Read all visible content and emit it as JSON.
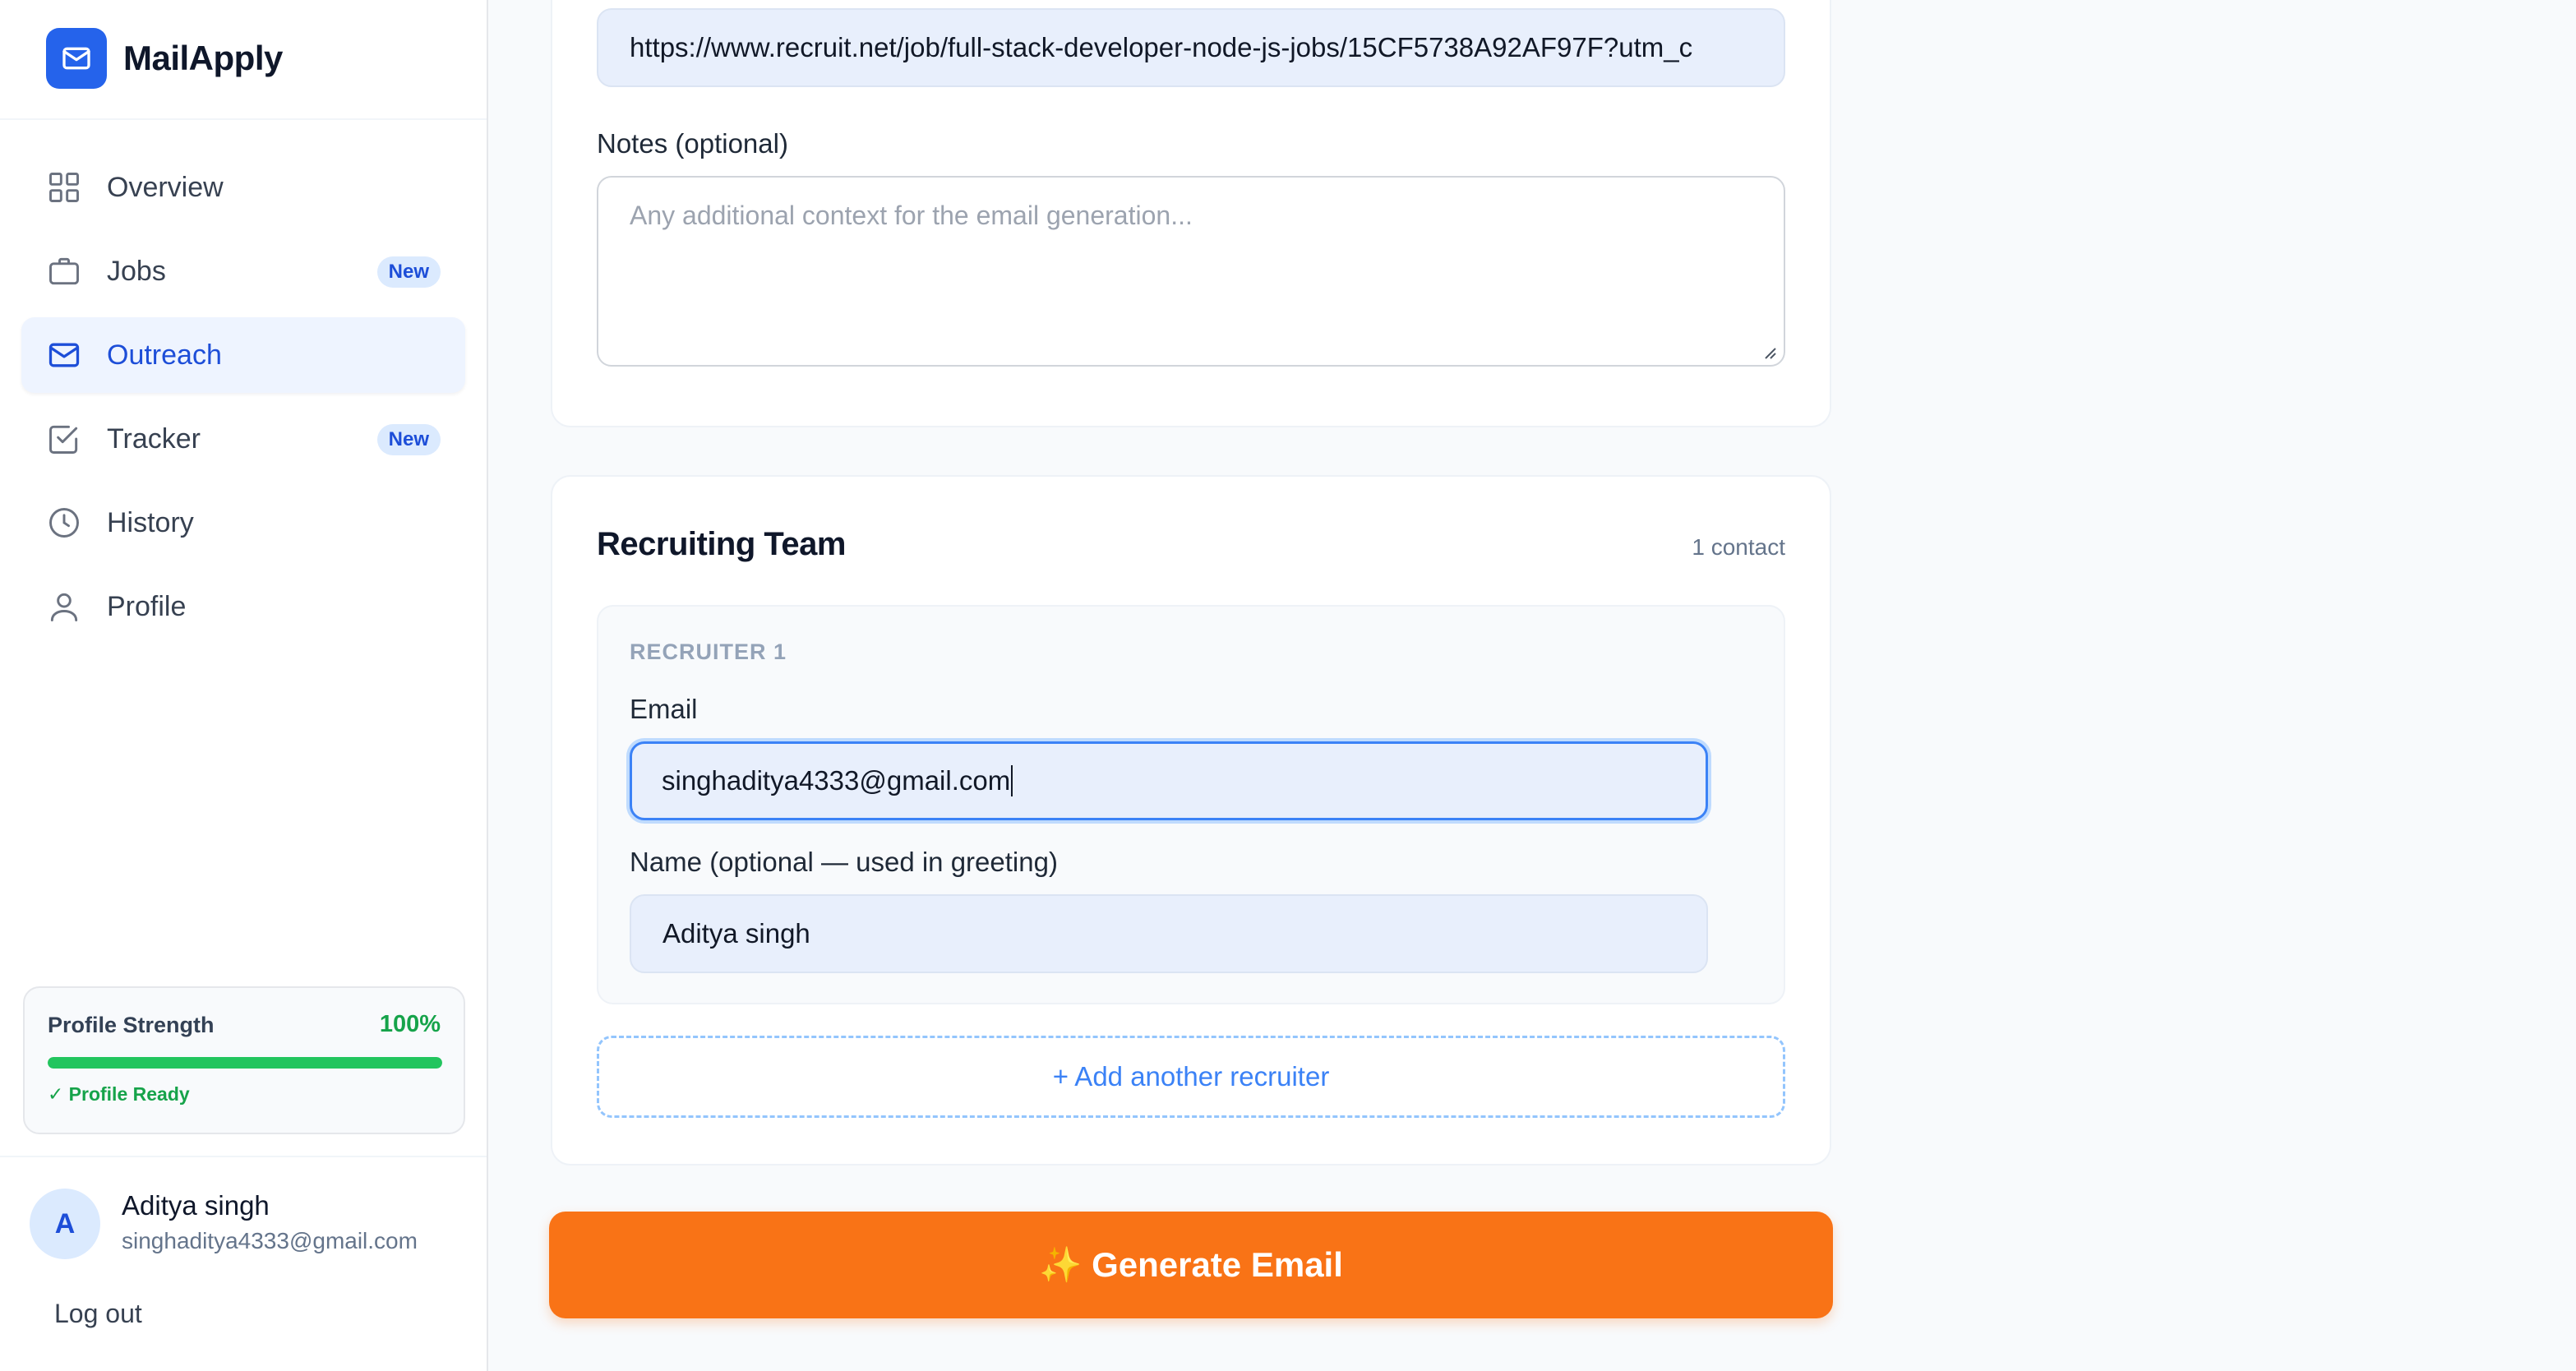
{
  "app": {
    "name": "MailApply"
  },
  "sidebar": {
    "items": [
      {
        "label": "Overview",
        "icon": "grid-icon"
      },
      {
        "label": "Jobs",
        "icon": "briefcase-icon",
        "badge": "New"
      },
      {
        "label": "Outreach",
        "icon": "mail-icon",
        "active": true
      },
      {
        "label": "Tracker",
        "icon": "check-square-icon",
        "badge": "New"
      },
      {
        "label": "History",
        "icon": "clock-icon"
      },
      {
        "label": "Profile",
        "icon": "user-icon"
      }
    ],
    "profile_strength": {
      "title": "Profile Strength",
      "percent_label": "100%",
      "value": 1.0,
      "status": "✓ Profile Ready"
    },
    "user": {
      "initial": "A",
      "name": "Aditya singh",
      "email": "singhaditya4333@gmail.com"
    },
    "logout_label": "Log out"
  },
  "form": {
    "job_url_value": "https://www.recruit.net/job/full-stack-developer-node-js-jobs/15CF5738A92AF97F?utm_c",
    "notes_label": "Notes (optional)",
    "notes_placeholder": "Any additional context for the email generation..."
  },
  "recruiting_team": {
    "title": "Recruiting Team",
    "count": "1 contact",
    "recruiters": [
      {
        "heading": "RECRUITER 1",
        "email_label": "Email",
        "email_value": "singhaditya4333@gmail.com",
        "name_label": "Name (optional — used in greeting)",
        "name_value": "Aditya singh"
      }
    ],
    "add_label": "+ Add another recruiter"
  },
  "generate_label": "✨ Generate Email",
  "colors": {
    "accent": "#2563eb",
    "cta": "#f97316",
    "success": "#22c55e"
  }
}
